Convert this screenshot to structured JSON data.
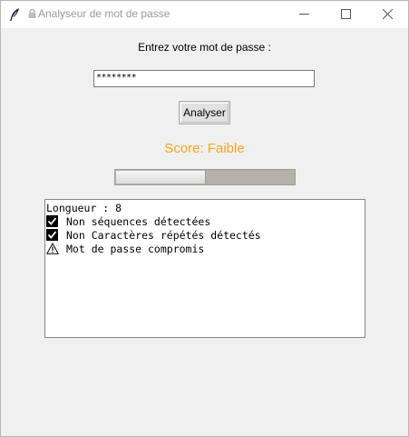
{
  "window": {
    "title": "Analyseur de mot de passe",
    "icons": {
      "app": "tk-feather-icon",
      "title_prefix": "lock-icon",
      "minimize": "minimize-icon",
      "maximize": "maximize-icon",
      "close": "close-icon"
    }
  },
  "form": {
    "prompt_label": "Entrez votre mot de passe :",
    "password_value": "********",
    "analyze_button": "Analyser"
  },
  "score": {
    "text": "Score: Faible",
    "color": "#f5a623",
    "progress_fraction": 0.5
  },
  "results": {
    "lines": [
      {
        "icon": "",
        "text": "Longueur : 8"
      },
      {
        "icon": "check-icon",
        "text": "Non séquences détectées"
      },
      {
        "icon": "check-icon",
        "text": "Non Caractères répétés détectés"
      },
      {
        "icon": "warning-icon",
        "text": "Mot de passe compromis"
      }
    ]
  }
}
